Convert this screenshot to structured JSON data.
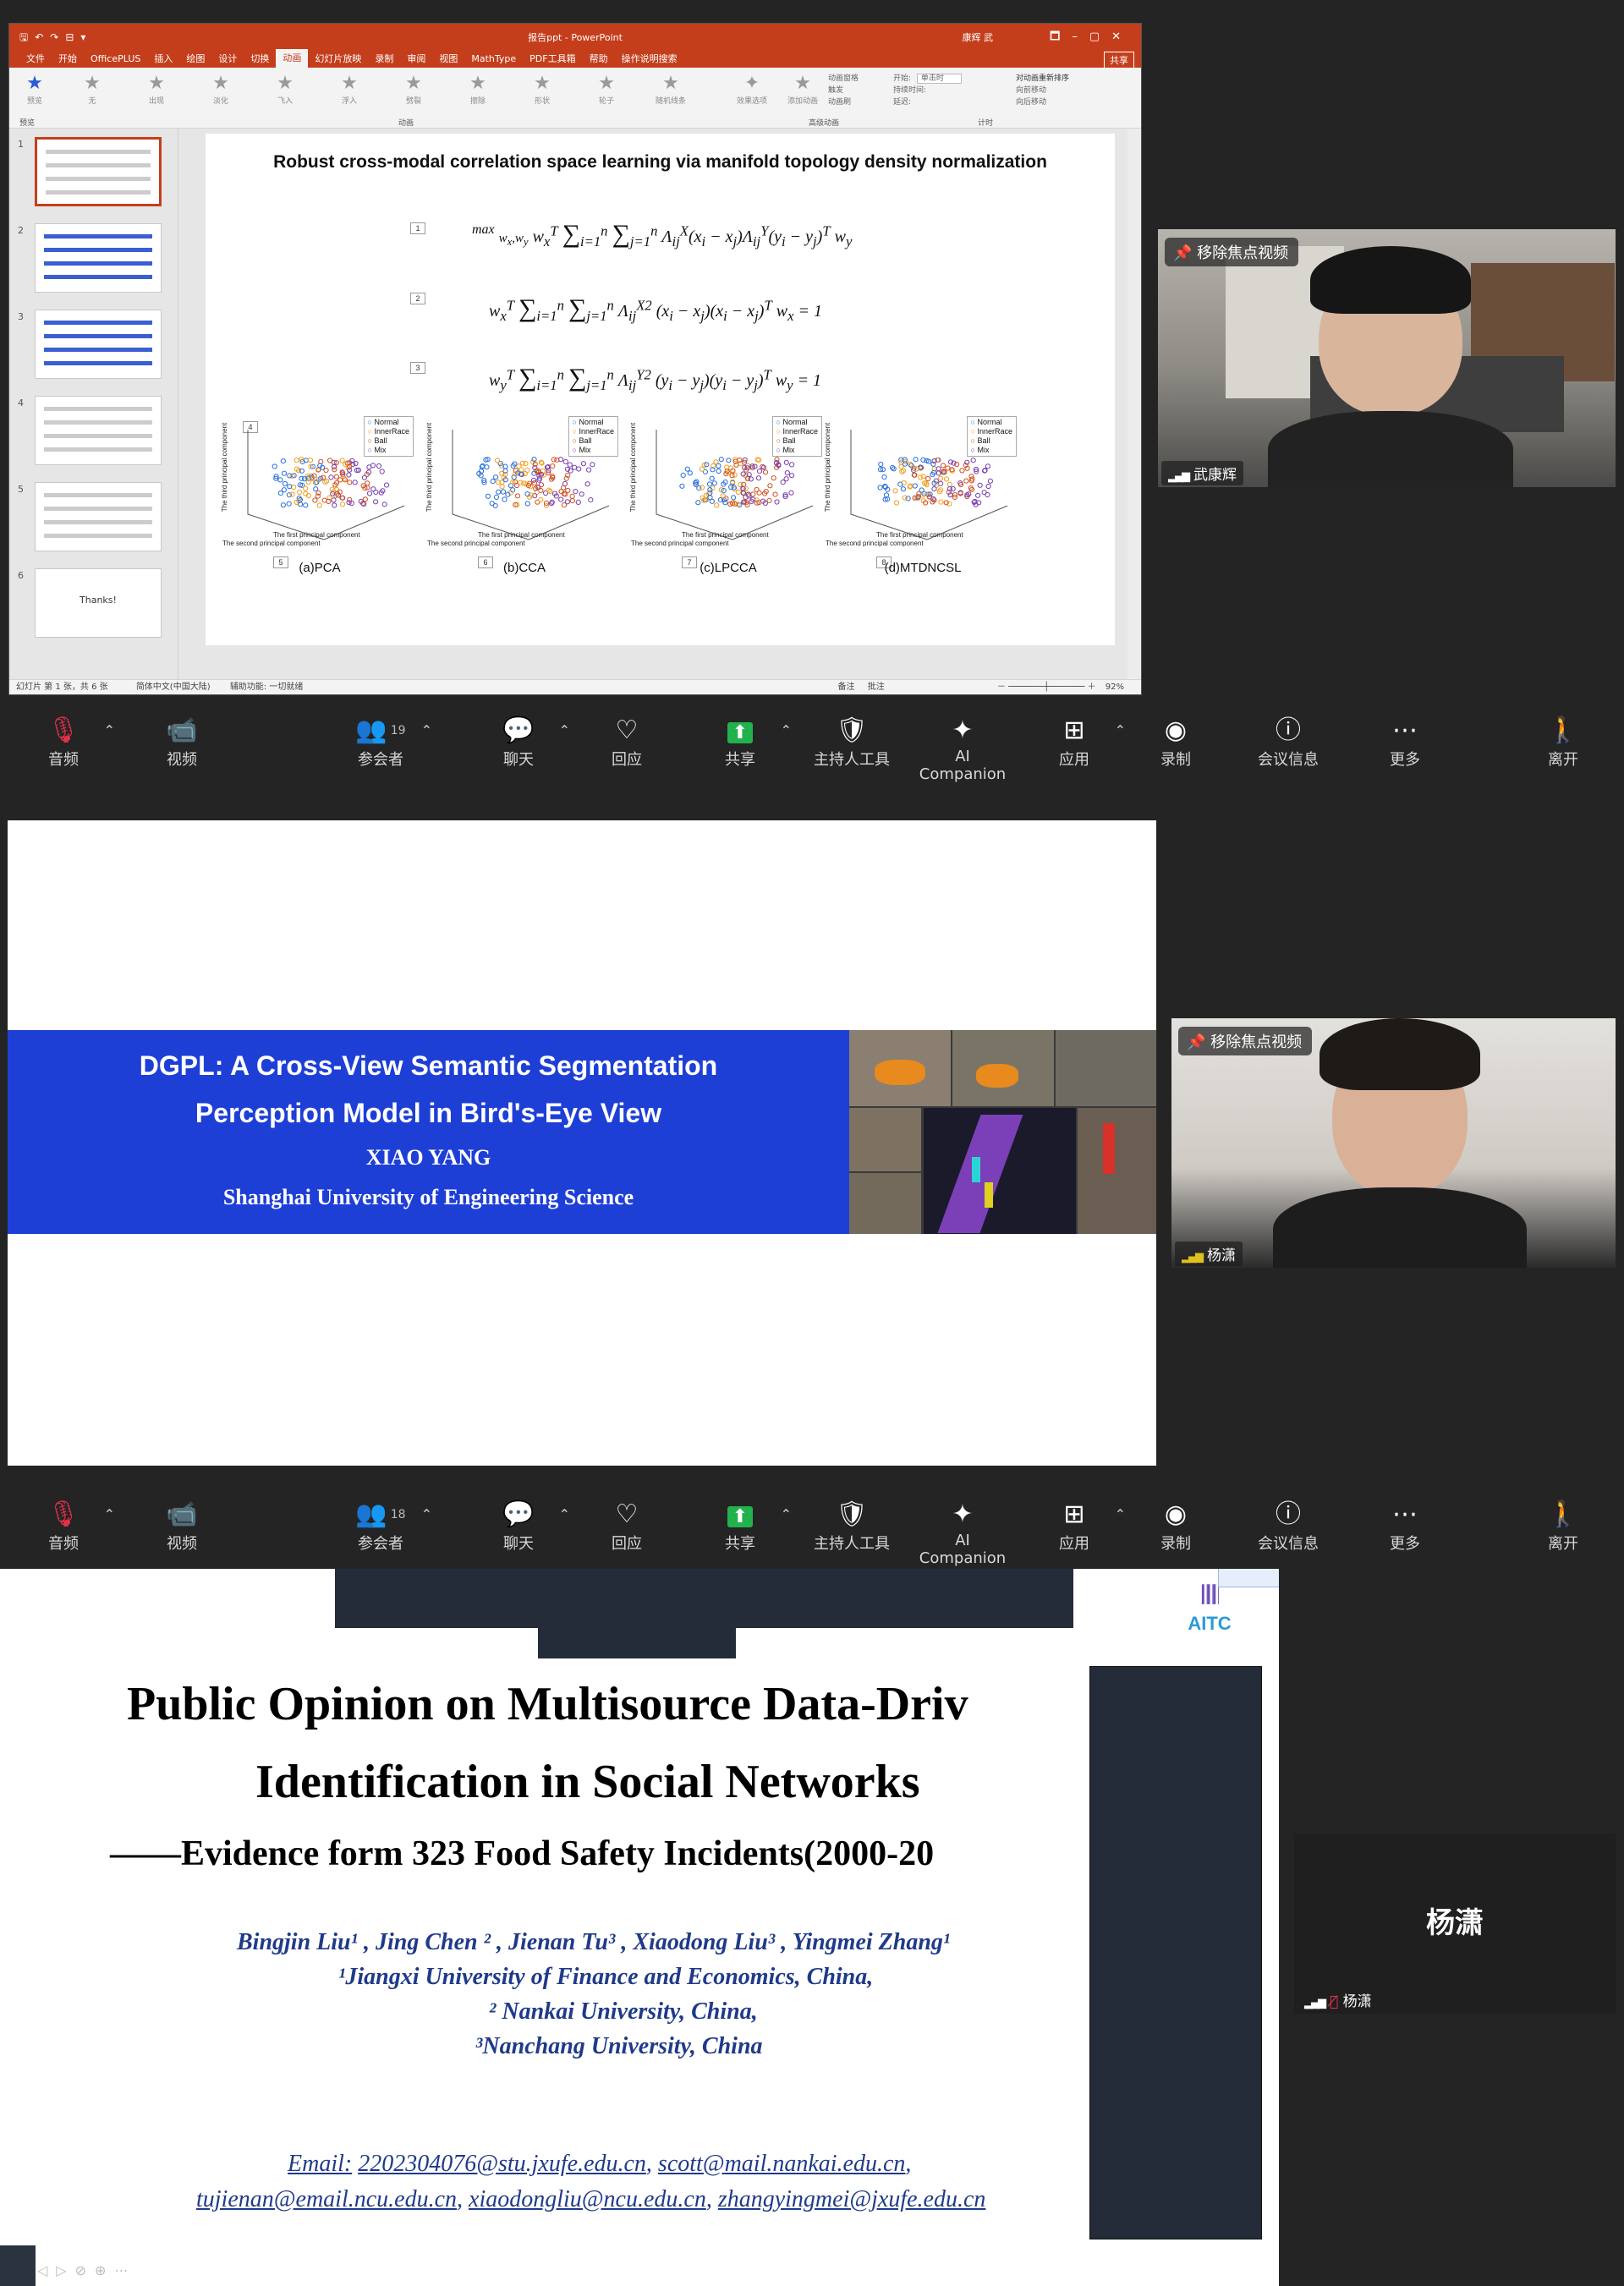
{
  "ppt": {
    "title": "报告ppt - PowerPoint",
    "user": "康辉 武",
    "menu": [
      "文件",
      "开始",
      "OfficePLUS",
      "插入",
      "绘图",
      "设计",
      "切换",
      "动画",
      "幻灯片放映",
      "录制",
      "审阅",
      "视图",
      "MathType",
      "PDF工具箱",
      "帮助",
      "操作说明搜索"
    ],
    "active_menu": "动画",
    "share": "共享",
    "ribbon_preview": "预览",
    "ribbon_items": [
      "无",
      "出现",
      "淡化",
      "飞入",
      "浮入",
      "劈裂",
      "擦除",
      "形状",
      "轮子",
      "随机线条"
    ],
    "effect_options": "效果选项",
    "add_animation": "添加动画",
    "animation_pane": "动画窗格",
    "trigger": "触发",
    "animation_painter": "动画刷",
    "start_label": "开始:",
    "start_value": "单击时",
    "duration_label": "持续时间:",
    "delay_label": "延迟:",
    "reorder": "对动画重新排序",
    "move_earlier": "向前移动",
    "move_later": "向后移动",
    "group_animation": "动画",
    "group_advanced": "高级动画",
    "group_timing": "计时",
    "group_preview": "预览",
    "thumb_last_text": "Thanks!",
    "status_left": "幻灯片 第 1 张，共 6 张",
    "status_lang": "简体中文(中国大陆)",
    "status_access": "辅助功能: 一切就绪",
    "status_notes": "备注",
    "status_comments": "批注",
    "zoom": "92%"
  },
  "slide1": {
    "title": "Robust cross-modal correlation space learning via manifold topology density normalization",
    "eq_numbers": [
      "1",
      "2",
      "3",
      "4",
      "5",
      "6",
      "7",
      "8"
    ],
    "captions": [
      "(a)PCA",
      "(b)CCA",
      "(c)LPCCA",
      "(d)MTDNCSL"
    ],
    "legend": [
      "Normal",
      "InnerRace",
      "Ball",
      "Mix"
    ],
    "xlabel": "The first principal component",
    "ylabel": "The second principal component",
    "zlabel": "The third principal component"
  },
  "tile1": {
    "pin": "移除焦点视频",
    "name": "武康辉"
  },
  "tile2": {
    "pin": "移除焦点视频",
    "name": "杨潇"
  },
  "tile3": {
    "big_name": "杨潇",
    "name": "杨潇"
  },
  "toolbar1": {
    "audio": "音频",
    "video": "视频",
    "participants": "参会者",
    "participants_count": "19",
    "chat": "聊天",
    "react": "回应",
    "share": "共享",
    "host_tools": "主持人工具",
    "ai": "AI Companion",
    "apps": "应用",
    "record": "录制",
    "info": "会议信息",
    "more": "更多",
    "leave": "离开"
  },
  "toolbar2": {
    "audio": "音频",
    "video": "视频",
    "participants": "参会者",
    "participants_count": "18",
    "chat": "聊天",
    "react": "回应",
    "share": "共享",
    "host_tools": "主持人工具",
    "ai": "AI Companion",
    "apps": "应用",
    "record": "录制",
    "info": "会议信息",
    "more": "更多",
    "leave": "离开"
  },
  "slide2": {
    "title_line1": "DGPL: A Cross-View Semantic Segmentation",
    "title_line2": "Perception Model in Bird's-Eye View",
    "author": "XIAO YANG",
    "affiliation": "Shanghai University of Engineering Science"
  },
  "slide3": {
    "logo": "AITC",
    "title_line1": "Public Opinion on Multisource Data-Driv",
    "title_line2": "Identification in Social Networks",
    "title_line3": "——Evidence form 323 Food Safety Incidents(2000-20",
    "authors": "Bingjin Liu¹ , Jing Chen ² , Jienan Tu³ , Xiaodong Liu³ , Yingmei Zhang¹",
    "aff1": "¹Jiangxi University of Finance and Economics, China,",
    "aff2": "² Nankai University, China,",
    "aff3": "³Nanchang University, China",
    "email_label": "Email:",
    "email1": "2202304076@stu.jxufe.edu.cn",
    "email2": "scott@mail.nankai.edu.cn",
    "email3": "tujienan@email.ncu.edu.cn",
    "email4": "xiaodongliu@ncu.edu.cn",
    "email5": "zhangyingmei@jxufe.edu.cn"
  },
  "colors": {
    "ppt_red": "#c43e1c",
    "dgpl_blue": "#1e3fd6",
    "zoom_bg": "#242424",
    "author_blue": "#1f3a8a"
  }
}
